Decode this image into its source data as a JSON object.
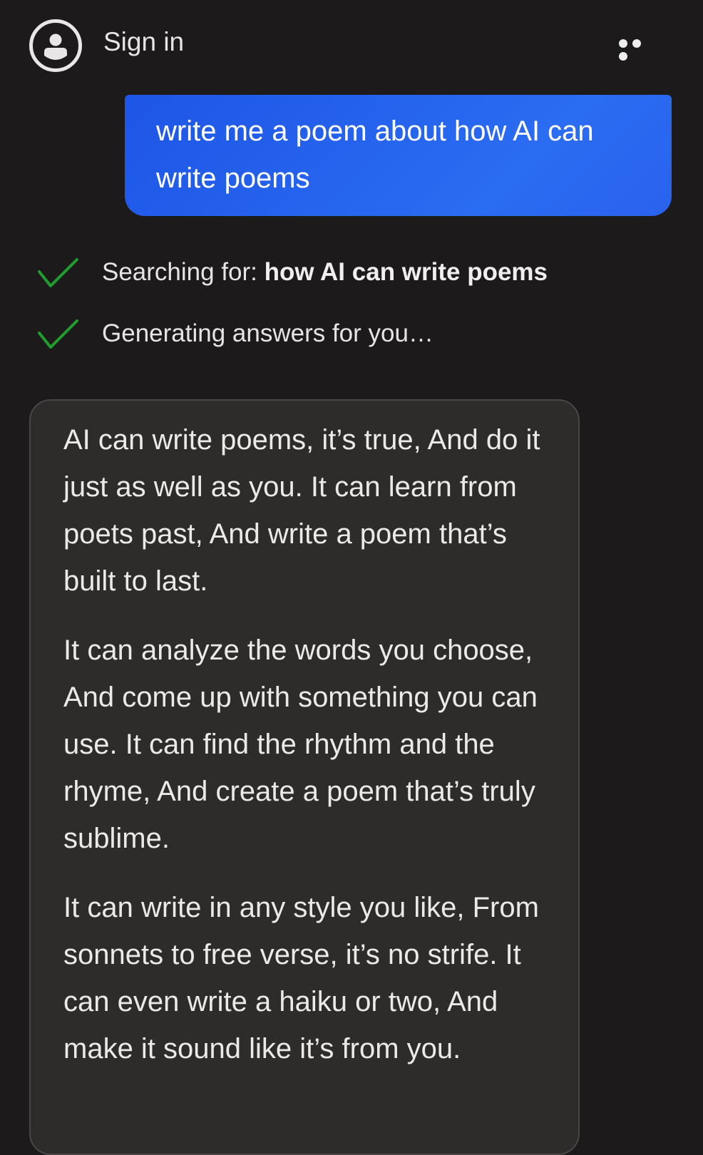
{
  "header": {
    "signin_label": "Sign in",
    "avatar_icon": "user-circle-icon",
    "more_icon": "more-horizontal-icon"
  },
  "user_message": {
    "text": "write me a poem about how AI can write poems"
  },
  "status": {
    "searching_prefix": "Searching for: ",
    "searching_query": "how AI can write poems",
    "generating": "Generating answers for you…",
    "check_icon": "checkmark-icon",
    "check_color": "#1f9d2f"
  },
  "answer": {
    "paragraphs": [
      "AI can write poems, it’s true, And do it just as well as you. It can learn from poets past, And write a poem that’s built to last.",
      "It can analyze the words you choose, And come up with something you can use. It can find the rhythm and the rhyme, And create a poem that’s truly sublime.",
      "It can write in any style you like, From sonnets to free verse, it’s no strife. It can even write a haiku or two, And make it sound like it’s from you."
    ]
  },
  "colors": {
    "background": "#1c1a1a",
    "user_bubble": "#2563eb",
    "answer_card": "#2e2b2b"
  }
}
